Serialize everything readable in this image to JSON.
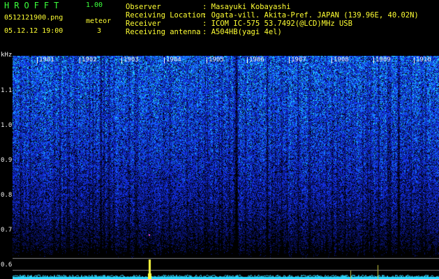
{
  "header": {
    "app_title": "HROFFT",
    "version": "1.00",
    "file_name": "0512121900.png",
    "datetime": "05.12.12 19:00",
    "meteor_label": "meteor",
    "meteor_count": "3"
  },
  "info": [
    {
      "label": "Observer",
      "value": ": Masayuki Kobayashi"
    },
    {
      "label": "Receiving Location",
      "value": ": Ogata-vill. Akita-Pref. JAPAN (139.96E, 40.02N)"
    },
    {
      "label": "Receiver",
      "value": ": ICOM IC-575 53.7492(@LCD)MHz USB"
    },
    {
      "label": "Receiving antenna",
      "value": ": A504HB(yagi 4el)"
    }
  ],
  "axis": {
    "unit": "kHz",
    "y_ticks": [
      "1.1",
      "1.0",
      "0.9",
      "0.8",
      "0.7",
      "0.6"
    ],
    "minute_labels": [
      "1901",
      "1902",
      "1903",
      "1904",
      "1905",
      "1906",
      "1907",
      "1908",
      "1909",
      "1910"
    ]
  },
  "colors": {
    "background": "#000000",
    "label_green": "#3cff3c",
    "label_yellow": "#ffff33",
    "text_white": "#f0f0f0",
    "noise_blue": "#1a3cff",
    "noise_cyan": "#30e0ff",
    "baseline_cyan": "#2fd8ff",
    "meteor_yellow": "#ffff40"
  }
}
